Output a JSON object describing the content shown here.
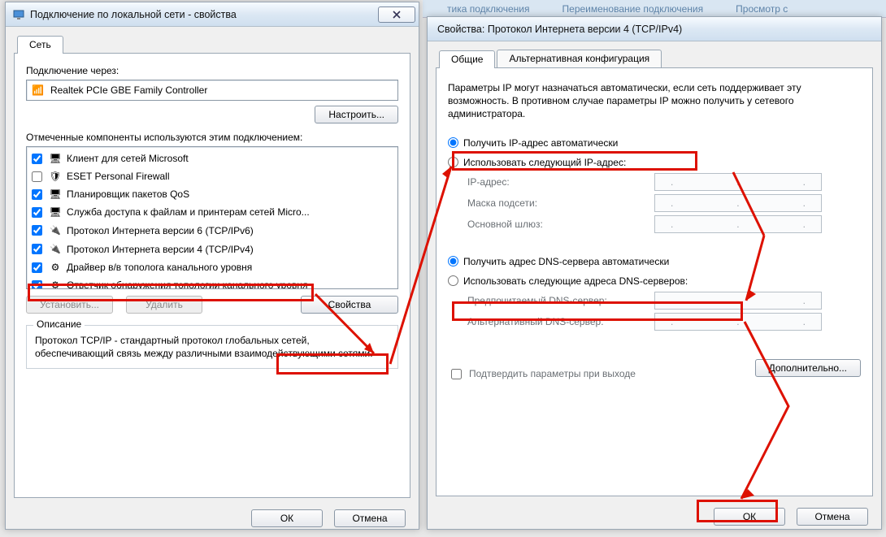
{
  "bgbar": {
    "item1": "тика подключения",
    "item2": "Переименование подключения",
    "item3": "Просмотр с"
  },
  "left": {
    "title": "Подключение по локальной сети - свойства",
    "tab": "Сеть",
    "connect_label": "Подключение через:",
    "adapter": "Realtek PCIe GBE Family Controller",
    "configure": "Настроить...",
    "components_label": "Отмеченные компоненты используются этим подключением:",
    "items": [
      {
        "label": "Клиент для сетей Microsoft",
        "checked": true,
        "icon": "svc"
      },
      {
        "label": "ESET Personal Firewall",
        "checked": false,
        "icon": "fw"
      },
      {
        "label": "Планировщик пакетов QoS",
        "checked": true,
        "icon": "svc"
      },
      {
        "label": "Служба доступа к файлам и принтерам сетей Micro...",
        "checked": true,
        "icon": "svc"
      },
      {
        "label": "Протокол Интернета версии 6 (TCP/IPv6)",
        "checked": true,
        "icon": "proto"
      },
      {
        "label": "Протокол Интернета версии 4 (TCP/IPv4)",
        "checked": true,
        "icon": "proto"
      },
      {
        "label": "Драйвер в/в тополога канального уровня",
        "checked": true,
        "icon": "drv"
      },
      {
        "label": "Ответчик обнаружения топологии канального уровня",
        "checked": true,
        "icon": "drv"
      }
    ],
    "install": "Установить...",
    "uninstall": "Удалить",
    "properties": "Свойства",
    "desc_title": "Описание",
    "desc_text": "Протокол TCP/IP - стандартный протокол глобальных сетей, обеспечивающий связь между различными взаимодействующими сетями.",
    "ok": "ОК",
    "cancel": "Отмена"
  },
  "right": {
    "title": "Свойства: Протокол Интернета версии 4 (TCP/IPv4)",
    "tabs": {
      "general": "Общие",
      "alt": "Альтернативная конфигурация"
    },
    "intro": "Параметры IP могут назначаться автоматически, если сеть поддерживает эту возможность. В противном случае параметры IP можно получить у сетевого администратора.",
    "ip_auto": "Получить IP-адрес автоматически",
    "ip_manual": "Использовать следующий IP-адрес:",
    "ip_fields": {
      "ip": "IP-адрес:",
      "mask": "Маска подсети:",
      "gw": "Основной шлюз:"
    },
    "dns_auto": "Получить адрес DNS-сервера автоматически",
    "dns_manual": "Использовать следующие адреса DNS-серверов:",
    "dns_fields": {
      "pref": "Предпочитаемый DNS-сервер:",
      "alt": "Альтернативный DNS-сервер:"
    },
    "confirm_exit": "Подтвердить параметры при выходе",
    "advanced": "Дополнительно...",
    "ok": "ОК",
    "cancel": "Отмена"
  }
}
